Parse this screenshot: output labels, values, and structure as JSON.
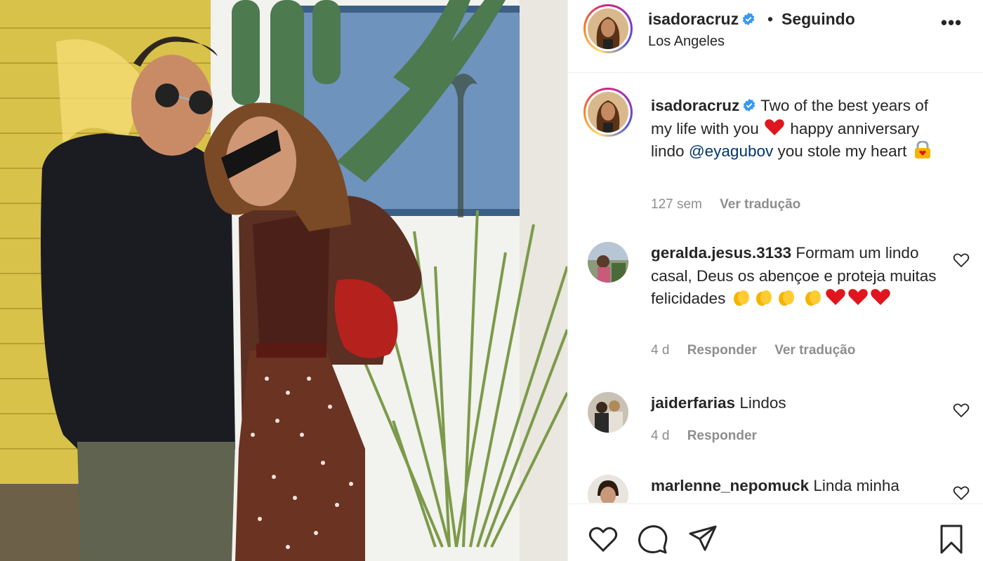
{
  "post": {
    "photo_description_icon": "post-photo"
  },
  "header": {
    "username": "isadoracruz",
    "separator": "•",
    "follow_state": "Seguindo",
    "location": "Los Angeles",
    "more_label": "•••"
  },
  "caption": {
    "username": "isadoracruz",
    "text_part1": "Two of the best years of my life with you",
    "text_part2": "happy anniversary lindo",
    "mention": "@eyagubov",
    "text_part3": "you stole my heart",
    "time": "127 sem",
    "translate": "Ver tradução"
  },
  "comments": [
    {
      "username": "geralda.jesus.3133",
      "text": "Formam um lindo casal, Deus os abençoe e proteja muitas felicidades",
      "time": "4 d",
      "reply": "Responder",
      "translate": "Ver tradução"
    },
    {
      "username": "jaiderfarias",
      "text": "Lindos",
      "time": "4 d",
      "reply": "Responder"
    },
    {
      "username": "marlenne_nepomuck",
      "text": "Linda minha"
    }
  ],
  "icons": {
    "verified": "verified-badge-icon",
    "like": "heart-icon",
    "comment": "comment-icon",
    "share": "share-icon",
    "save": "bookmark-icon",
    "more": "more-options-icon"
  },
  "colors": {
    "verified_blue": "#3897f0",
    "mention_blue": "#00376b",
    "muted_gray": "#8e8e8e",
    "text": "#262626"
  }
}
